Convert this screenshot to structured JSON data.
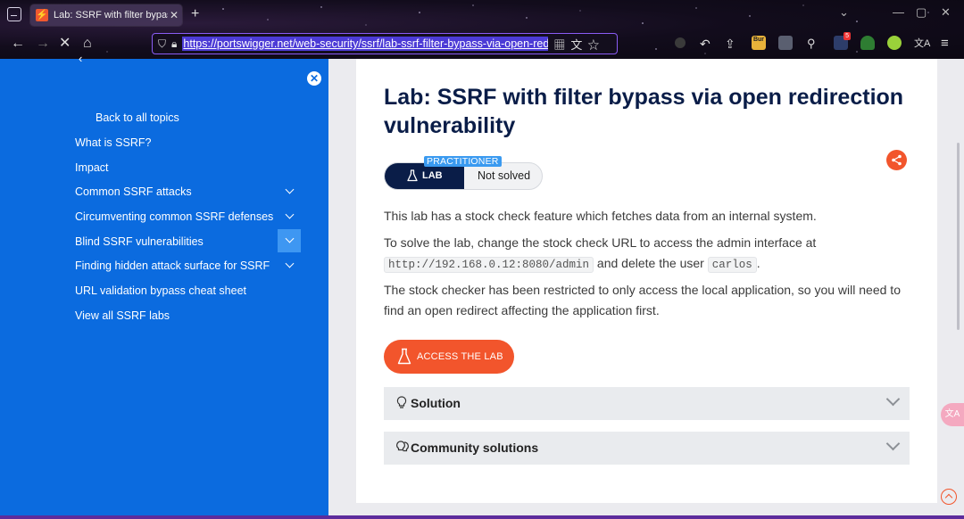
{
  "browser": {
    "tab_title": "Lab: SSRF with filter bypass v",
    "new_tab": "+",
    "url": "https://portswigger.net/web-security/ssrf/lab-ssrf-filter-bypass-via-open-redirect",
    "extension_badge": "Bur",
    "extension_count": "5"
  },
  "sidebar": {
    "back_label": "Back to all topics",
    "items": [
      {
        "label": "What is SSRF?"
      },
      {
        "label": "Impact"
      },
      {
        "label": "Common SSRF attacks"
      },
      {
        "label": "Circumventing common SSRF defenses"
      },
      {
        "label": "Blind SSRF vulnerabilities"
      },
      {
        "label": "Finding hidden attack surface for SSRF"
      },
      {
        "label": "URL validation bypass cheat sheet"
      },
      {
        "label": "View all SSRF labs"
      }
    ]
  },
  "lab": {
    "title": "Lab: SSRF with filter bypass via open redirection vulnerability",
    "level": "PRACTITIONER",
    "badge_label": "LAB",
    "status": "Not solved",
    "p1": "This lab has a stock check feature which fetches data from an internal system.",
    "p2_prefix": "To solve the lab, change the stock check URL to access the admin interface at",
    "p2_code_url": "http://192.168.0.12:8080/admin",
    "p2_mid": " and delete the user ",
    "p2_code_user": "carlos",
    "p2_suffix": ".",
    "p3_line1": "The stock checker has been restricted to only access the local application, so you will need to",
    "p3_line2": "find an open redirect affecting the application first.",
    "access_button": "ACCESS THE LAB",
    "accordions": [
      {
        "label": "Solution"
      },
      {
        "label": "Community solutions"
      }
    ]
  },
  "colors": {
    "sidebar_bg": "#0b6bdf",
    "navy": "#0a1d48",
    "accent_orange": "#f2552c",
    "practitioner_blue": "#3a9af0"
  }
}
